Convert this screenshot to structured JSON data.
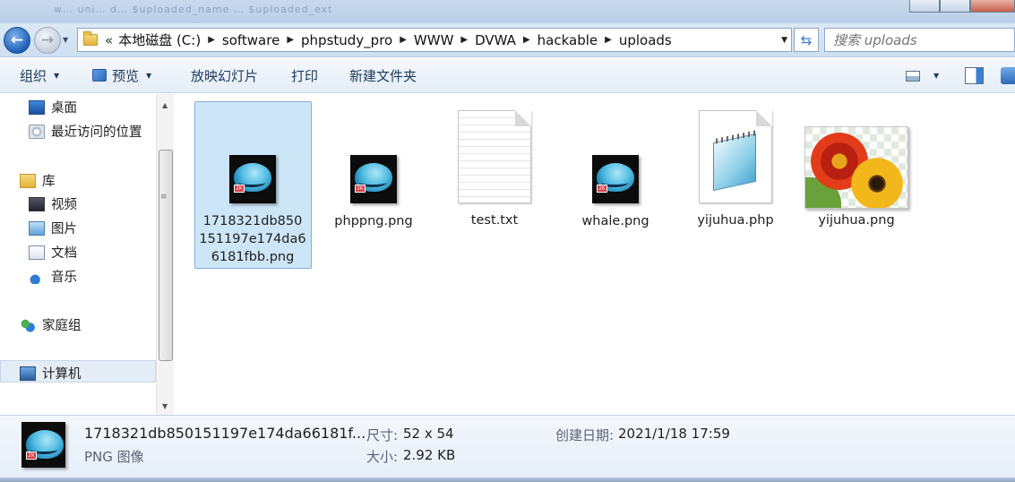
{
  "title_bar": {
    "faded_text": "w… uni… d… $uploaded_name … $uploaded_ext"
  },
  "address": {
    "overflow": "«",
    "crumbs": [
      "本地磁盘 (C:)",
      "software",
      "phpstudy_pro",
      "WWW",
      "DVWA",
      "hackable",
      "uploads"
    ]
  },
  "search": {
    "placeholder": "搜索 uploads"
  },
  "toolbar": {
    "organize": "组织",
    "preview": "预览",
    "slideshow": "放映幻灯片",
    "print": "打印",
    "new_folder": "新建文件夹"
  },
  "nav": {
    "desktop": "桌面",
    "recent": "最近访问的位置",
    "libraries": "库",
    "videos": "视频",
    "pictures": "图片",
    "documents": "文档",
    "music": "音乐",
    "homegroup": "家庭组",
    "computer": "计算机"
  },
  "files": [
    {
      "name": "1718321db850\n151197e174da6\n6181fbb.png",
      "icon": "whale-image-icon",
      "selected": true
    },
    {
      "name": "phppng.png",
      "icon": "whale-image-icon",
      "selected": false
    },
    {
      "name": "test.txt",
      "icon": "text-document-icon",
      "selected": false
    },
    {
      "name": "whale.png",
      "icon": "whale-image-icon",
      "selected": false
    },
    {
      "name": "yijuhua.php",
      "icon": "notepad-document-icon",
      "selected": false
    },
    {
      "name": "yijuhua.png",
      "icon": "flowers-image-icon",
      "selected": false
    }
  ],
  "details": {
    "filename": "1718321db850151197e174da66181f...",
    "filetype": "PNG 图像",
    "dimensions_label": "尺寸:",
    "dimensions_value": "52 x 54",
    "size_label": "大小:",
    "size_value": "2.92 KB",
    "created_label": "创建日期:",
    "created_value": "2021/1/18 17:59"
  },
  "colors": {
    "selection_fill": "#cde6f7",
    "selection_border": "#84acdd",
    "toolbar_text": "#1e395b",
    "back_button": "#1f5fb8"
  }
}
